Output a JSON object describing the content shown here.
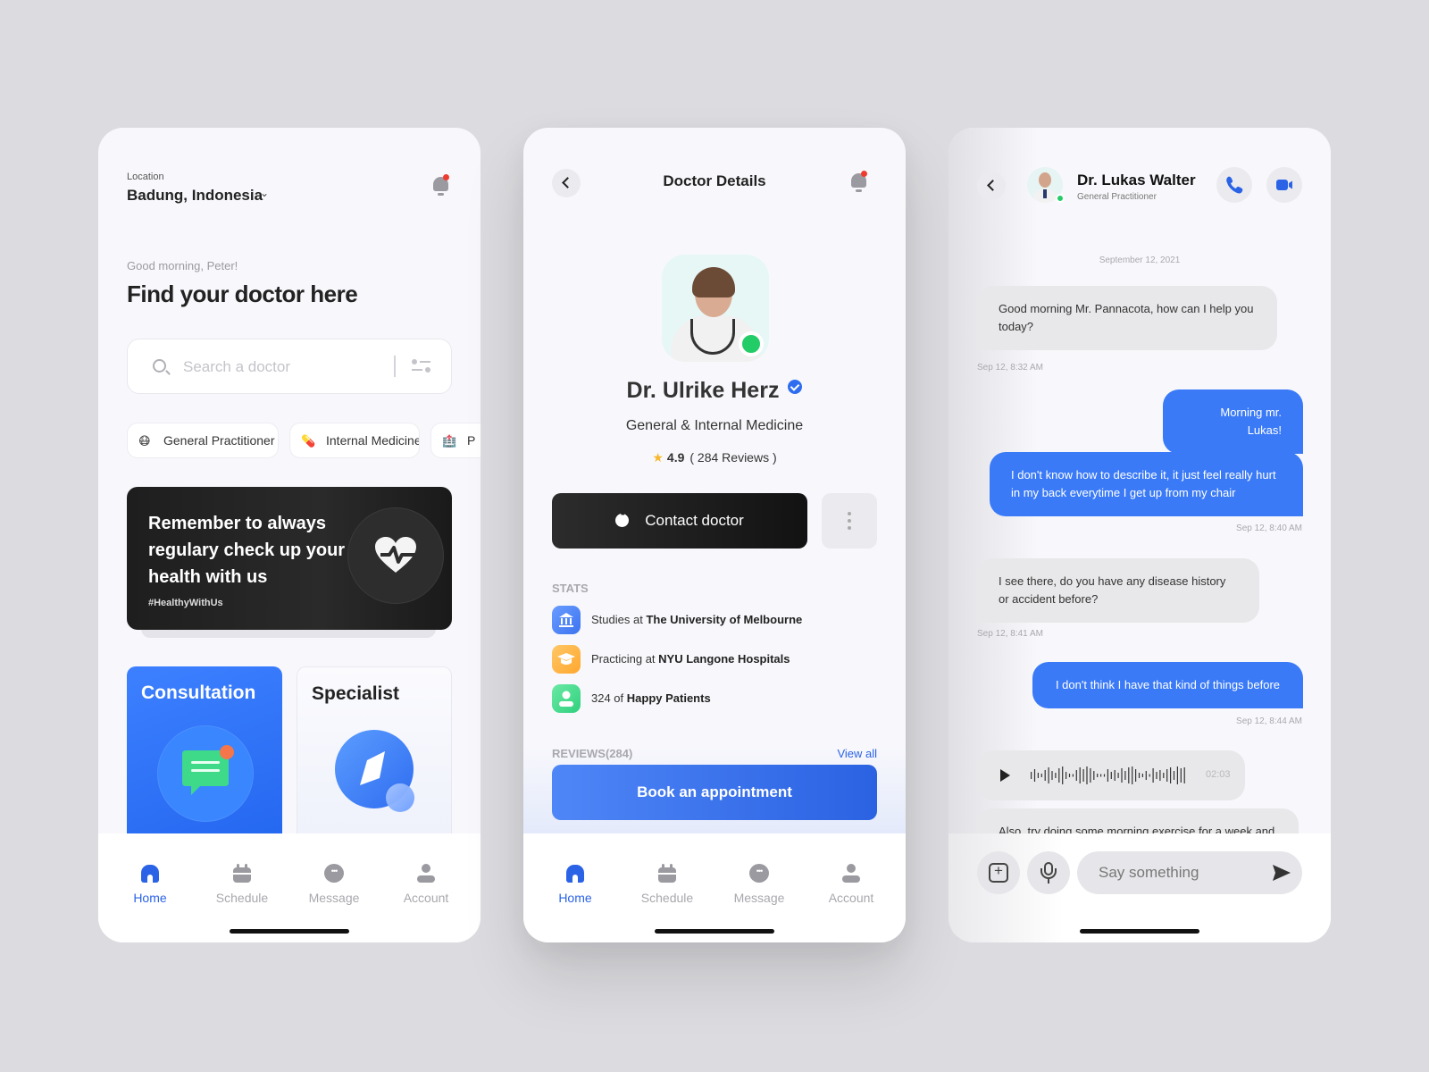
{
  "home": {
    "location_label": "Location",
    "location_value": "Badung, Indonesia",
    "greeting": "Good morning, Peter!",
    "headline": "Find your doctor here",
    "search_placeholder": "Search a doctor",
    "categories": [
      {
        "emoji": "😷",
        "label": "General Practitioner"
      },
      {
        "emoji": "💊",
        "label": "Internal Medicine"
      },
      {
        "emoji": "🏥",
        "label": "P"
      }
    ],
    "banner": {
      "text": "Remember to always regulary check up your health with us",
      "tag": "#HealthyWithUs"
    },
    "cards": {
      "consultation": "Consultation",
      "specialist": "Specialist"
    }
  },
  "doctor": {
    "title": "Doctor Details",
    "name": "Dr. Ulrike Herz",
    "specialty": "General & Internal Medicine",
    "rating": "4.9",
    "reviews_text": "( 284 Reviews )",
    "contact_label": "Contact doctor",
    "stats_label": "STATS",
    "stats": [
      {
        "prefix": "Studies at ",
        "bold": "The University of Melbourne",
        "icon": "university-icon",
        "color": "#4f86f7"
      },
      {
        "prefix": "Practicing at ",
        "bold": "NYU Langone Hospitals",
        "icon": "graduation-cap-icon",
        "color": "#ffb84a"
      },
      {
        "prefix": "324 of ",
        "bold": "Happy Patients",
        "icon": "patient-icon",
        "color": "#3fd98a"
      }
    ],
    "reviews_label": "REVIEWS(284)",
    "view_all": "View all",
    "book_label": "Book an appointment"
  },
  "chat": {
    "doctor_name": "Dr. Lukas Walter",
    "doctor_role": "General Practitioner",
    "date": "September 12, 2021",
    "messages": [
      {
        "dir": "in",
        "text": "Good morning Mr. Pannacota, how can I help you today?",
        "time": "Sep 12, 8:32 AM"
      },
      {
        "dir": "out",
        "text": "Morning mr. Lukas!",
        "time": ""
      },
      {
        "dir": "out",
        "text": "I don't know how to describe it, it just feel really hurt in my back everytime I get up from my chair",
        "time": "Sep 12, 8:40 AM"
      },
      {
        "dir": "in",
        "text": "I see there, do you have any disease history or accident before?",
        "time": "Sep 12, 8:41 AM"
      },
      {
        "dir": "out",
        "text": "I don't think I have that kind of things before",
        "time": "Sep 12, 8:44 AM"
      },
      {
        "dir": "in",
        "text": "Also, try doing some morning exercise for a week and",
        "time": ""
      }
    ],
    "voice_duration": "02:03",
    "input_placeholder": "Say something"
  },
  "tabbar": {
    "items": [
      "Home",
      "Schedule",
      "Message",
      "Account"
    ],
    "active": "Home"
  },
  "colors": {
    "accent": "#2b63e6",
    "bubble_out": "#3a7af7",
    "bubble_in": "#e8e8ea",
    "online": "#22cc66",
    "notification": "#ee3b30"
  }
}
